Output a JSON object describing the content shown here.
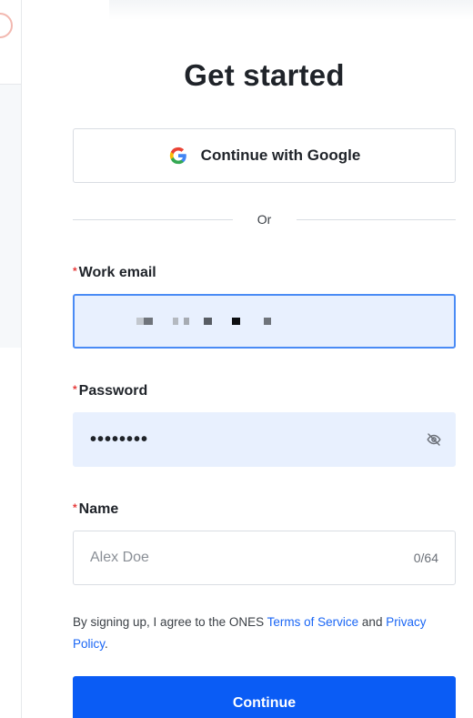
{
  "title": "Get started",
  "google": {
    "label": "Continue with Google",
    "icon": "google-g-icon"
  },
  "divider": {
    "label": "Or"
  },
  "email": {
    "label": "Work email",
    "required_mark": "*"
  },
  "password": {
    "label": "Password",
    "required_mark": "*",
    "value": "••••••••",
    "toggle_icon": "eye-slash-icon"
  },
  "name": {
    "label": "Name",
    "required_mark": "*",
    "placeholder": "Alex Doe",
    "counter": "0/64"
  },
  "terms": {
    "prefix": "By signing up, I agree to the ONES ",
    "terms_link": "Terms of Service",
    "middle": " and ",
    "privacy_link": "Privacy Policy",
    "suffix": "."
  },
  "continue": {
    "label": "Continue"
  },
  "colors": {
    "primary": "#0a5cf5",
    "link": "#1a66f5",
    "required": "#e63a3a",
    "autofill": "#e8f0fe"
  }
}
